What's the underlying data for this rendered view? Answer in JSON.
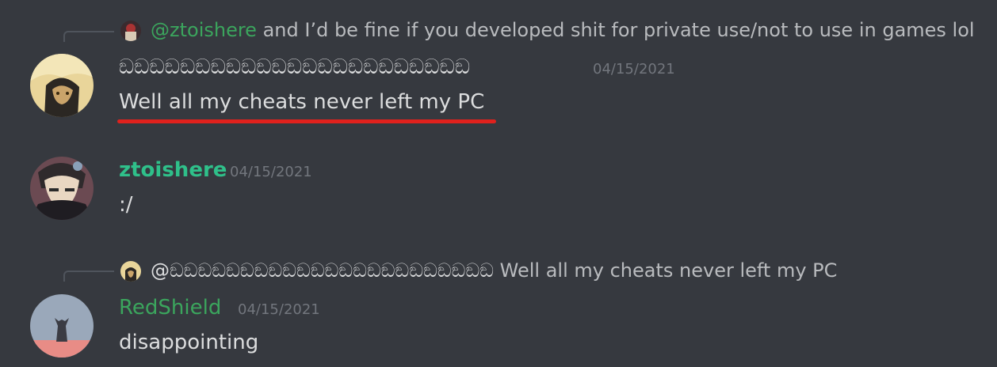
{
  "messages": [
    {
      "reply": {
        "mention": "@ztoishere",
        "text": "and I’d be fine if you developed shit for private use/not to use in games lol"
      },
      "author": "ඞඞඞඞඞඞඞඞඞඞඞඞඞඞඞඞඞඞඞඞඞඞඞ",
      "timestamp": "04/15/2021",
      "content": "Well all my cheats never left my PC"
    },
    {
      "author": "ztoishere",
      "timestamp": "04/15/2021",
      "content": ":/"
    },
    {
      "reply": {
        "mention": "@ඞඞඞඞඞඞඞඞඞඞඞඞඞඞඞඞඞඞඞඞඞඞඞ",
        "text": "Well all my cheats never left my PC"
      },
      "author": "RedShield",
      "timestamp": "04/15/2021",
      "content": "disappointing"
    }
  ],
  "colors": {
    "background": "#36393f",
    "mention_green": "#3ba55d",
    "ztoishere_name": "#2fc08a",
    "redshield_name": "#3ba55d",
    "underline": "#e0211d"
  }
}
